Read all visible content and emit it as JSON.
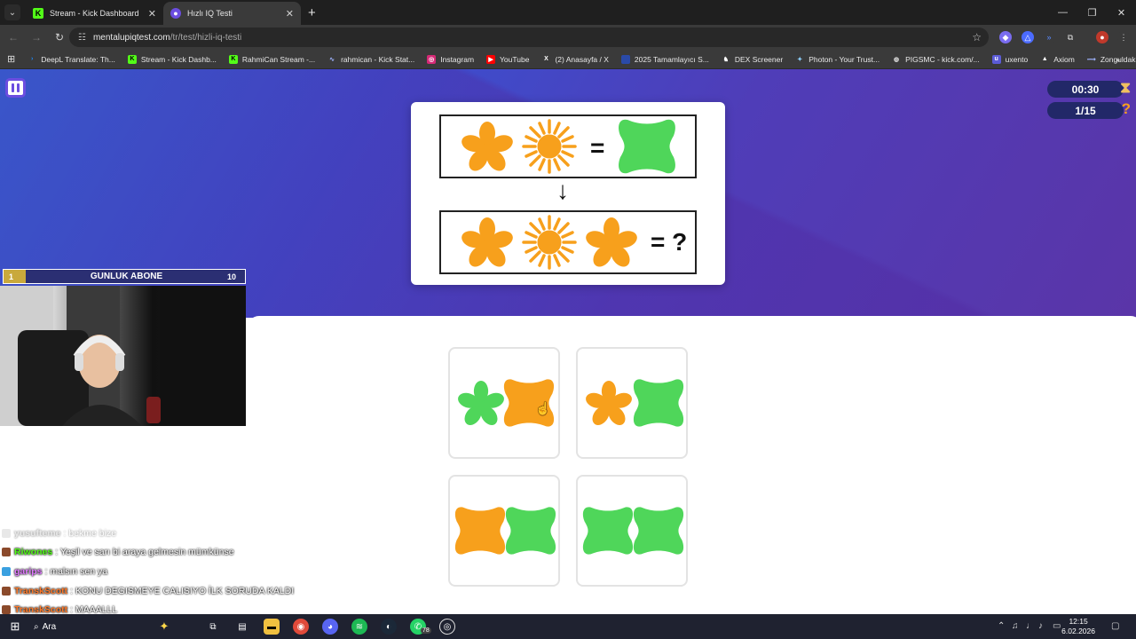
{
  "browser": {
    "tabs": [
      {
        "title": "Stream - Kick Dashboard",
        "active": false
      },
      {
        "title": "Hızlı IQ Testi",
        "active": true
      }
    ],
    "url_domain": "mentalupiqtest.com",
    "url_path": "/tr/test/hizli-iq-testi",
    "bookmarks": [
      {
        "label": "DeepL Translate: Th...",
        "icon": "deepl-icon"
      },
      {
        "label": "Stream - Kick Dashb...",
        "icon": "kick-icon"
      },
      {
        "label": "RahmiCan Stream -...",
        "icon": "kick-icon"
      },
      {
        "label": "rahmican - Kick Stat...",
        "icon": "kickstats-icon"
      },
      {
        "label": "Instagram",
        "icon": "instagram-icon"
      },
      {
        "label": "YouTube",
        "icon": "youtube-icon"
      },
      {
        "label": "(2) Anasayfa / X",
        "icon": "x-icon"
      },
      {
        "label": "2025 Tamamlayıcı S...",
        "icon": "doc-icon"
      },
      {
        "label": "DEX Screener",
        "icon": "dexscreener-icon"
      },
      {
        "label": "Photon - Your Trust...",
        "icon": "photon-icon"
      },
      {
        "label": "PIGSMC - kick.com/...",
        "icon": "globe-icon"
      },
      {
        "label": "uxento",
        "icon": "uxento-icon"
      },
      {
        "label": "Axiom",
        "icon": "axiom-icon"
      },
      {
        "label": "Zonguldak İngilizce...",
        "icon": "zonguldak-icon"
      }
    ]
  },
  "game": {
    "timer": "00:30",
    "progress": "1/15",
    "question": {
      "top_row_equals": "=",
      "bottom_row_equals": "= ?",
      "arrow": "↓"
    },
    "options": [
      {
        "id": "a",
        "shapes": [
          "green-flower",
          "orange-clover"
        ]
      },
      {
        "id": "b",
        "shapes": [
          "orange-flower",
          "green-clover"
        ]
      },
      {
        "id": "c",
        "shapes": [
          "orange-clover",
          "green-clover"
        ]
      },
      {
        "id": "d",
        "shapes": [
          "green-clover",
          "green-clover"
        ]
      }
    ],
    "colors": {
      "orange": "#f7a01c",
      "green": "#4fd65a",
      "bg_purple": "#4f3db8"
    }
  },
  "overlay": {
    "subgoal": {
      "start": "1",
      "label": "GUNLUK ABONE",
      "goal": "10"
    },
    "chat": [
      {
        "user": "yusufteme",
        "text": ": bekme bize",
        "faded": true,
        "user_color": "#c0c0c0"
      },
      {
        "user": "Riwones",
        "text": ": Yeşil ve sarı bi araya gelmesin mümkünse",
        "faded": false,
        "user_color": "#53fc18"
      },
      {
        "user": "garips",
        "text": ": malsın sen ya",
        "faded": false,
        "user_color": "#e07bff"
      },
      {
        "user": "TranskScott",
        "text": ": KONU DEGISMEYE CALISIYO İLK SORUDA KALDI",
        "faded": false,
        "user_color": "#ff7a2a"
      },
      {
        "user": "TranskScott",
        "text": ": MAAALLL",
        "faded": false,
        "user_color": "#ff7a2a"
      }
    ]
  },
  "taskbar": {
    "search_label": "Ara",
    "time": "12:15",
    "date": "6.02.2026",
    "whatsapp_badge": "78"
  }
}
